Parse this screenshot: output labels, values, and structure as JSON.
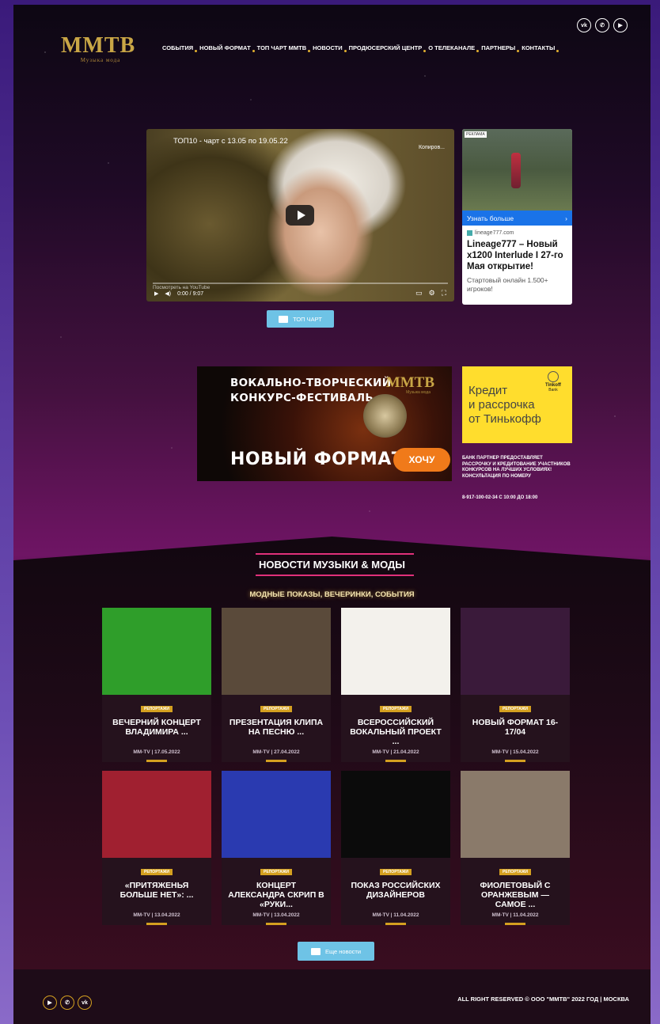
{
  "header": {
    "logo": "MMTB",
    "logo_sub": "Музыка мода",
    "nav": [
      "СОБЫТИЯ",
      "НОВЫЙ ФОРМАТ",
      "ТОП ЧАРТ ММТВ",
      "НОВОСТИ",
      "ПРОДЮСЕРСКИЙ ЦЕНТР",
      "О ТЕЛЕКАНАЛЕ",
      "ПАРТНЕРЫ",
      "КОНТАКТЫ"
    ],
    "social": [
      "vk",
      "whatsapp",
      "youtube"
    ]
  },
  "video": {
    "title": "ТОП10 - чарт с 13.05 по 19.05.22",
    "copy_label": "Копиров...",
    "watch_on": "Посмотреть на YouTube",
    "time": "0:00 / 9:07"
  },
  "ad1": {
    "badge": "РЕКЛАМА",
    "more": "Узнать больше",
    "domain": "lineage777.com",
    "title": "Lineage777 – Новый x1200 Interlude I 27-го Мая открытие!",
    "desc": "Стартовый онлайн 1.500+ игроков!"
  },
  "top_chart_button": "ТОП ЧАРТ",
  "banner": {
    "line1": "ВОКАЛЬНО-ТВОРЧЕСКИЙ",
    "line2": "КОНКУРС-ФЕСТИВАЛЬ",
    "logo": "MMTB",
    "logo_sub": "Музыка мода",
    "line3": "НОВЫЙ ФОРМАТ",
    "button": "ХОЧУ"
  },
  "tinkoff": {
    "text1": "Кредит",
    "text2": "и рассрочка",
    "text3": "от Тинькофф",
    "logo": "Tinkoff",
    "logo_sub": "Bank",
    "bank_text": "БАНК ПАРТНЕР ПРЕДОСТАВЛЯЕТ РАССРОЧКУ И КРЕДИТОВАНИЕ УЧАСТНИКОВ КОНКУРСОВ НА ЛУЧШИХ УСЛОВИЯХ! КОНСУЛЬТАЦИЯ ПО НОМЕРУ",
    "phone": "8-917-100-02-34 С 10:00 ДО 18:00"
  },
  "news": {
    "title": "НОВОСТИ МУЗЫКИ & МОДЫ",
    "subtitle": "МОДНЫЕ ПОКАЗЫ, ВЕЧЕРИНКИ, СОБЫТИЯ",
    "cards": [
      {
        "tag": "РЕПОРТАЖИ",
        "title": "ВЕЧЕРНИЙ КОНЦЕРТ ВЛАДИМИРА ...",
        "meta": "MM-TV | 17.05.2022",
        "img": "#2f9e2a"
      },
      {
        "tag": "РЕПОРТАЖИ",
        "title": "ПРЕЗЕНТАЦИЯ КЛИПА НА ПЕСНЮ ...",
        "meta": "MM-TV | 27.04.2022",
        "img": "#5a4a3a"
      },
      {
        "tag": "РЕПОРТАЖИ",
        "title": "ВСЕРОССИЙСКИЙ ВОКАЛЬНЫЙ ПРОЕКТ ...",
        "meta": "MM-TV | 21.04.2022",
        "img": "#f3f1ec"
      },
      {
        "tag": "РЕПОРТАЖИ",
        "title": "НОВЫЙ ФОРМАТ 16-17/04",
        "meta": "MM-TV | 15.04.2022",
        "img": "#3a1a3a"
      },
      {
        "tag": "РЕПОРТАЖИ",
        "title": "«ПРИТЯЖЕНЬЯ БОЛЬШЕ НЕТ»: ...",
        "meta": "MM-TV | 13.04.2022",
        "img": "#a02030"
      },
      {
        "tag": "РЕПОРТАЖИ",
        "title": "КОНЦЕРТ АЛЕКСАНДРА СКРИП В «РУКИ...",
        "meta": "MM-TV | 13.04.2022",
        "img": "#2a3ab0"
      },
      {
        "tag": "РЕПОРТАЖИ",
        "title": "ПОКАЗ РОССИЙСКИХ ДИЗАЙНЕРОВ",
        "meta": "MM-TV | 11.04.2022",
        "img": "#0b0b0b"
      },
      {
        "tag": "РЕПОРТАЖИ",
        "title": "ФИОЛЕТОВЫЙ С ОРАНЖЕВЫМ — САМОЕ ...",
        "meta": "MM-TV | 11.04.2022",
        "img": "#8a7a6a"
      }
    ],
    "more_button": "Еще новости"
  },
  "footer": {
    "social": [
      "youtube",
      "whatsapp",
      "vk"
    ],
    "copyright": "ALL RIGHT RESERVED © ООО \"ММТВ\" 2022 ГОД | МОСКВА"
  }
}
